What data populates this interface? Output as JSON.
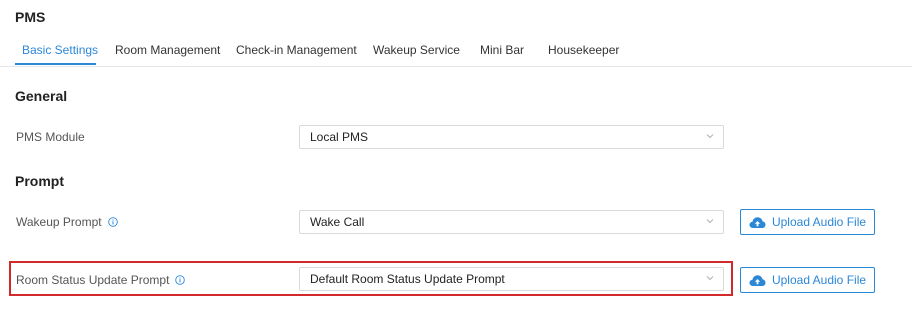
{
  "app": {
    "title": "PMS"
  },
  "tabs": [
    {
      "label": "Basic Settings",
      "active": true
    },
    {
      "label": "Room Management"
    },
    {
      "label": "Check-in Management"
    },
    {
      "label": "Wakeup Service"
    },
    {
      "label": "Mini Bar"
    },
    {
      "label": "Housekeeper"
    }
  ],
  "general": {
    "heading": "General",
    "pms_module": {
      "label": "PMS Module",
      "value": "Local PMS"
    }
  },
  "prompt": {
    "heading": "Prompt",
    "wakeup": {
      "label": "Wakeup Prompt",
      "value": "Wake Call",
      "upload_label": "Upload Audio File"
    },
    "room_status": {
      "label": "Room Status Update Prompt",
      "value": "Default Room Status Update Prompt",
      "upload_label": "Upload Audio File"
    }
  },
  "colors": {
    "accent": "#2b87d8",
    "highlight": "#d22a2a"
  },
  "icons": {
    "info": "info-circle-icon",
    "upload": "cloud-upload-icon",
    "dropdown": "chevron-down-icon"
  }
}
